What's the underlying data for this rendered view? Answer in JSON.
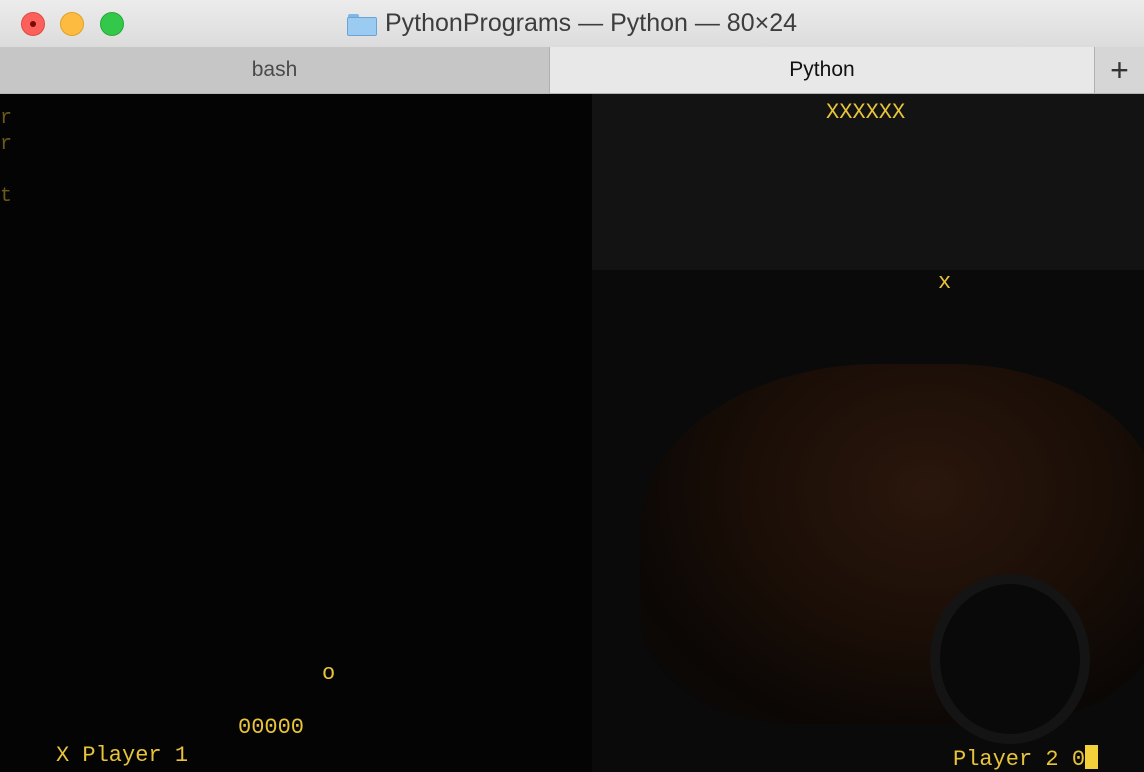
{
  "window": {
    "title": "PythonPrograms — Python — 80×24"
  },
  "icons": {
    "title_folder": "folder-icon",
    "close": "close-button",
    "minimize": "minimize-button",
    "maximize": "zoom-button",
    "new_tab": "plus-icon"
  },
  "tabs": [
    {
      "label": "bash",
      "active": false
    },
    {
      "label": "Python",
      "active": true
    }
  ],
  "new_tab_label": "+",
  "terminal": {
    "text_color": "#e8c43a",
    "top_row": "XXXXXX",
    "ball_x": "x",
    "ball_o": "o",
    "bottom_row": "00000",
    "player1_label": "X Player 1",
    "player2_label": "Player 2 0"
  }
}
